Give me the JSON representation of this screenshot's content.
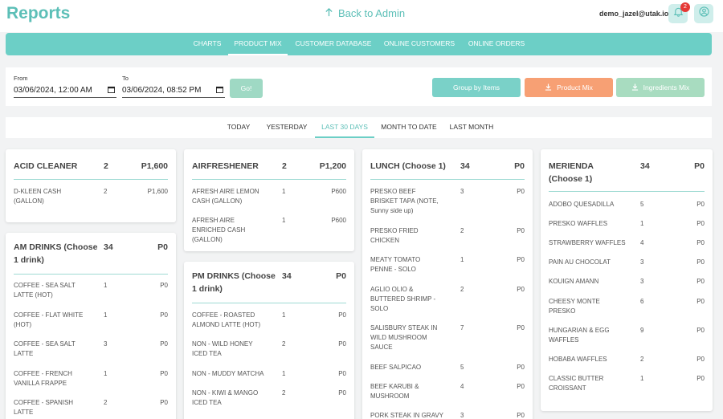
{
  "app": {
    "title": "Reports",
    "back_label": "Back to Admin",
    "email": "demo_jazel@utak.io",
    "notification_count": "2"
  },
  "nav": {
    "tabs": [
      {
        "label": "CHARTS"
      },
      {
        "label": "PRODUCT MIX",
        "active": true
      },
      {
        "label": "CUSTOMER DATABASE"
      },
      {
        "label": "ONLINE CUSTOMERS"
      },
      {
        "label": "ONLINE ORDERS"
      }
    ]
  },
  "filters": {
    "from_label": "From",
    "from_value": "03/06/2024, 12:00 AM",
    "to_label": "To",
    "to_value": "03/06/2024, 08:52 PM",
    "go_label": "Go!",
    "group_label": "Group by Items",
    "product_mix_label": "Product Mix",
    "ingredients_label": "Ingredients Mix"
  },
  "ranges": {
    "tabs": [
      {
        "label": "TODAY"
      },
      {
        "label": "YESTERDAY"
      },
      {
        "label": "LAST 30 DAYS",
        "active": true
      },
      {
        "label": "MONTH TO DATE"
      },
      {
        "label": "LAST MONTH"
      }
    ]
  },
  "cards": [
    {
      "name": "ACID CLEANER",
      "qty": "2",
      "total": "P1,600",
      "items": [
        {
          "name": "D-KLEEN CASH (GALLON)",
          "qty": "2",
          "total": "P1,600"
        }
      ]
    },
    {
      "name": "AM DRINKS (Choose 1 drink)",
      "qty": "34",
      "total": "P0",
      "items": [
        {
          "name": "COFFEE - SEA SALT LATTE (HOT)",
          "qty": "1",
          "total": "P0"
        },
        {
          "name": "COFFEE - FLAT WHITE (HOT)",
          "qty": "1",
          "total": "P0"
        },
        {
          "name": "COFFEE - SEA SALT LATTE",
          "qty": "3",
          "total": "P0"
        },
        {
          "name": "COFFEE - FRENCH VANILLA FRAPPE",
          "qty": "1",
          "total": "P0"
        },
        {
          "name": "COFFEE - SPANISH LATTE",
          "qty": "2",
          "total": "P0"
        }
      ]
    },
    {
      "name": "AIRFRESHENER",
      "qty": "2",
      "total": "P1,200",
      "items": [
        {
          "name": "AFRESH AIRE LEMON CASH (GALLON)",
          "qty": "1",
          "total": "P600"
        },
        {
          "name": "AFRESH AIRE ENRICHED CASH (GALLON)",
          "qty": "1",
          "total": "P600"
        }
      ]
    },
    {
      "name": "PM DRINKS (Choose 1 drink)",
      "qty": "34",
      "total": "P0",
      "items": [
        {
          "name": "COFFEE - ROASTED ALMOND LATTE (HOT)",
          "qty": "1",
          "total": "P0"
        },
        {
          "name": "NON - WILD HONEY ICED TEA",
          "qty": "2",
          "total": "P0"
        },
        {
          "name": "NON - MUDDY MATCHA",
          "qty": "1",
          "total": "P0"
        },
        {
          "name": "NON - KIWI & MANGO ICED TEA",
          "qty": "2",
          "total": "P0"
        }
      ]
    },
    {
      "name": "LUNCH (Choose 1)",
      "qty": "34",
      "total": "P0",
      "items": [
        {
          "name": "PRESKO BEEF BRISKET TAPA (NOTE, Sunny side up)",
          "qty": "3",
          "total": "P0"
        },
        {
          "name": "PRESKO FRIED CHICKEN",
          "qty": "2",
          "total": "P0"
        },
        {
          "name": "MEATY TOMATO PENNE - SOLO",
          "qty": "1",
          "total": "P0"
        },
        {
          "name": "AGLIO OLIO & BUTTERED SHRIMP - SOLO",
          "qty": "2",
          "total": "P0"
        },
        {
          "name": "SALISBURY STEAK IN WILD MUSHROOM SAUCE",
          "qty": "7",
          "total": "P0"
        },
        {
          "name": "BEEF SALPICAO",
          "qty": "5",
          "total": "P0"
        },
        {
          "name": "BEEF KARUBI & MUSHROOM",
          "qty": "4",
          "total": "P0"
        },
        {
          "name": "PORK STEAK IN GRAVY",
          "qty": "3",
          "total": "P0"
        }
      ]
    },
    {
      "name": "MERIENDA (Choose 1)",
      "qty": "34",
      "total": "P0",
      "items": [
        {
          "name": "ADOBO QUESADILLA",
          "qty": "5",
          "total": "P0"
        },
        {
          "name": "PRESKO WAFFLES",
          "qty": "1",
          "total": "P0"
        },
        {
          "name": "STRAWBERRY WAFFLES",
          "qty": "4",
          "total": "P0"
        },
        {
          "name": "PAIN AU CHOCOLAT",
          "qty": "3",
          "total": "P0"
        },
        {
          "name": "KOUIGN AMANN",
          "qty": "3",
          "total": "P0"
        },
        {
          "name": "CHEESY MONTE PRESKO",
          "qty": "6",
          "total": "P0"
        },
        {
          "name": "HUNGARIAN & EGG WAFFLES",
          "qty": "9",
          "total": "P0"
        },
        {
          "name": "HOBABA WAFFLES",
          "qty": "2",
          "total": "P0"
        },
        {
          "name": "CLASSIC BUTTER CROISSANT",
          "qty": "1",
          "total": "P0"
        }
      ]
    }
  ],
  "colors": {
    "accent": "#6ccfc6",
    "orange": "#f7a074",
    "mint": "#a8dcc0",
    "badge": "#e53935"
  },
  "icons": {
    "back": "arrow-up-icon",
    "bell": "bell-icon",
    "user": "user-circle-icon",
    "calendar": "calendar-icon",
    "download": "download-icon"
  }
}
